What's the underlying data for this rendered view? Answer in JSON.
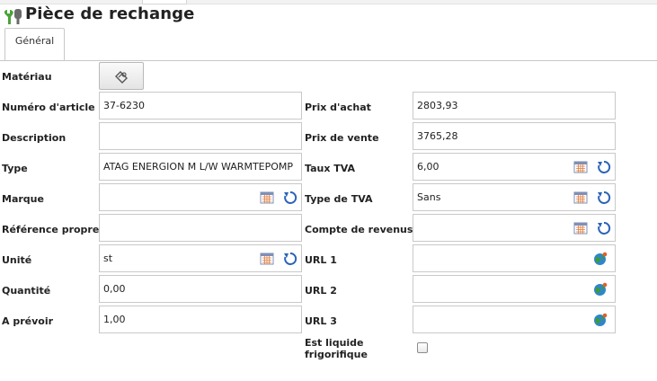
{
  "title": "Pièce de rechange",
  "tabs": [
    {
      "label": "Général"
    }
  ],
  "left": [
    {
      "key": "materiau",
      "label": "Matériau",
      "value": "",
      "icons": []
    },
    {
      "key": "numero",
      "label": "Numéro d'article",
      "value": "37-6230",
      "icons": []
    },
    {
      "key": "description",
      "label": "Description",
      "value": "",
      "icons": []
    },
    {
      "key": "type",
      "label": "Type",
      "value": "ATAG ENERGION M L/W WARMTEPOMP",
      "icons": []
    },
    {
      "key": "marque",
      "label": "Marque",
      "value": "",
      "icons": [
        "calendar-icon",
        "refresh-icon"
      ]
    },
    {
      "key": "reference",
      "label": "Référence propre",
      "value": "",
      "icons": []
    },
    {
      "key": "unite",
      "label": "Unité",
      "value": "st",
      "icons": [
        "calendar-icon",
        "refresh-icon"
      ]
    },
    {
      "key": "quantite",
      "label": "Quantité",
      "value": "0,00",
      "icons": []
    },
    {
      "key": "aprevoir",
      "label": "A prévoir",
      "value": "1,00",
      "icons": []
    }
  ],
  "right": [
    {
      "key": "prix-achat",
      "label": "Prix d'achat",
      "value": "2803,93",
      "icons": []
    },
    {
      "key": "prix-vente",
      "label": "Prix de vente",
      "value": "3765,28",
      "icons": []
    },
    {
      "key": "taux-tva",
      "label": "Taux TVA",
      "value": "6,00",
      "icons": [
        "calendar-icon",
        "refresh-icon"
      ]
    },
    {
      "key": "type-tva",
      "label": "Type de TVA",
      "value": "Sans",
      "icons": [
        "calendar-icon",
        "refresh-icon"
      ]
    },
    {
      "key": "compte-revenus",
      "label": "Compte de revenus",
      "value": "",
      "icons": [
        "calendar-icon",
        "refresh-icon"
      ]
    },
    {
      "key": "url1",
      "label": "URL 1",
      "value": "",
      "icons": [
        "globe-icon"
      ]
    },
    {
      "key": "url2",
      "label": "URL 2",
      "value": "",
      "icons": [
        "globe-icon"
      ]
    },
    {
      "key": "url3",
      "label": "URL 3",
      "value": "",
      "icons": [
        "globe-icon"
      ]
    }
  ],
  "liquide": {
    "label": "Est liquide frigorifique",
    "checked": false
  },
  "colors": {
    "label": "#222222",
    "border": "#c9c9c9",
    "calendar": "#7f8fb6",
    "refresh": "#2a63b8",
    "globe": "#2f86c9"
  }
}
